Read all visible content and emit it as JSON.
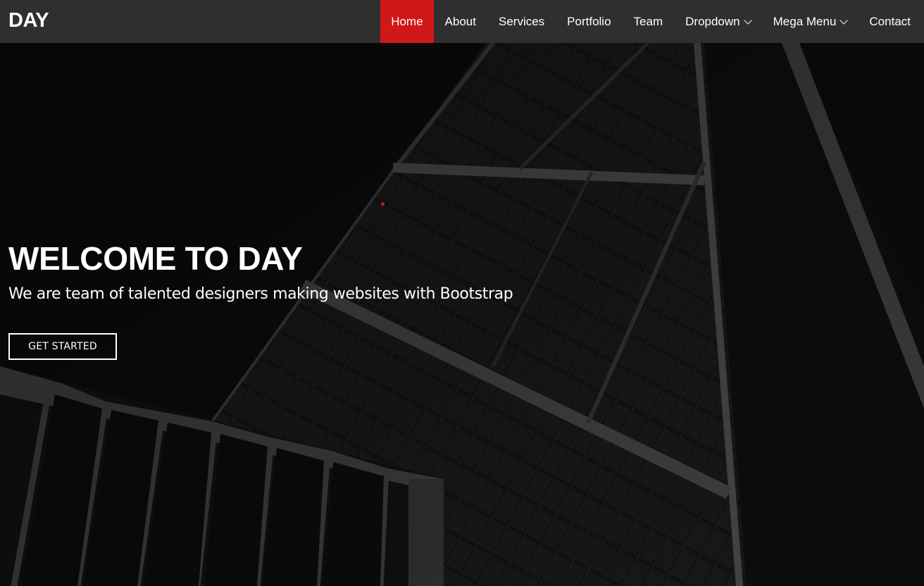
{
  "brand": {
    "logo": "DAY"
  },
  "nav": {
    "items": [
      {
        "label": "Home",
        "active": true
      },
      {
        "label": "About"
      },
      {
        "label": "Services"
      },
      {
        "label": "Portfolio"
      },
      {
        "label": "Team"
      },
      {
        "label": "Dropdown",
        "has_dropdown": true
      },
      {
        "label": "Mega Menu",
        "has_dropdown": true
      },
      {
        "label": "Contact"
      }
    ]
  },
  "hero": {
    "title": "WELCOME TO DAY",
    "subtitle": "We are team of talented designers making websites with Bootstrap",
    "cta_label": "GET STARTED"
  },
  "colors": {
    "accent": "#d11818",
    "header_bg": "#2f2f2f",
    "hero_bg": "#0f0f0f",
    "text": "#ffffff"
  },
  "icons": {
    "dropdown": "chevron-down-icon"
  }
}
